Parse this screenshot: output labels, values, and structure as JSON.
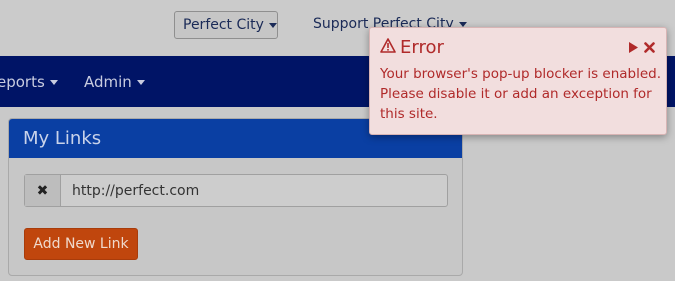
{
  "topbar": {
    "city_label": "Perfect City",
    "support_label": "Support Perfect City"
  },
  "nav": {
    "items": [
      {
        "label": "eports"
      },
      {
        "label": "Admin"
      }
    ]
  },
  "panel": {
    "title": "My Links",
    "link_value": "http://perfect.com",
    "add_button_label": "Add New Link"
  },
  "error": {
    "title": "Error",
    "message": "Your browser's pop-up blocker is enabled. Please disable it or add an exception for this site."
  },
  "colors": {
    "navbar": "#001466",
    "panel_header": "#0a3fa3",
    "add_button": "#c0460d",
    "error_bg": "#f2dede",
    "error_text": "#b02a2a"
  },
  "icons": {
    "remove": "close-icon",
    "warning": "warning-icon",
    "play": "play-icon",
    "close": "close-icon"
  }
}
